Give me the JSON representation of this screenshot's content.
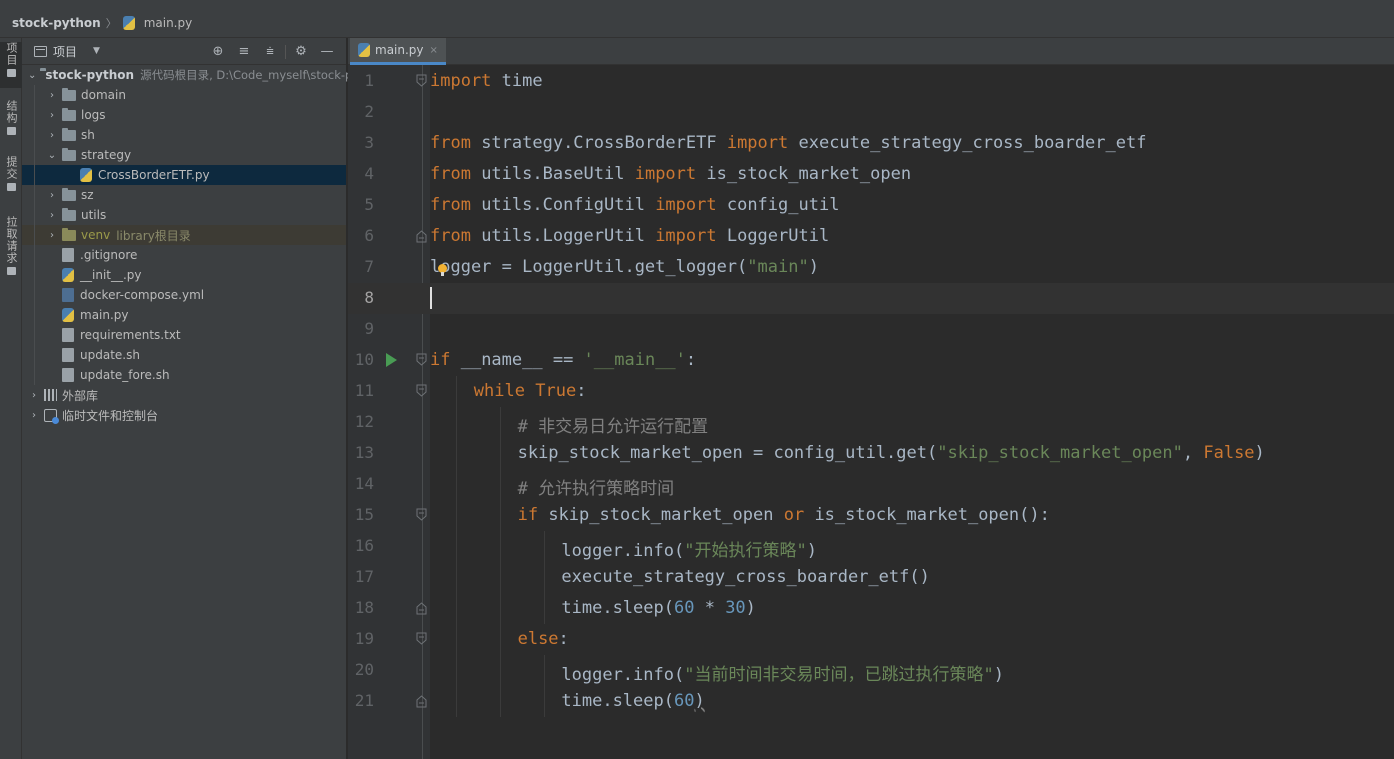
{
  "breadcrumb": {
    "project": "stock-python",
    "file": "main.py"
  },
  "left_strip": [
    {
      "label": "项目",
      "icon": "folder-icon"
    },
    {
      "label": "结构",
      "icon": "structure-icon"
    },
    {
      "label": "提交",
      "icon": "commit-icon"
    },
    {
      "label": "拉取请求",
      "icon": "pull-request-icon"
    }
  ],
  "project_panel": {
    "title": "项目",
    "root": {
      "name": "stock-python",
      "hint": "源代码根目录, D:\\Code_myself\\stock-python"
    },
    "tree": [
      {
        "type": "folder",
        "name": "domain",
        "depth": 1,
        "expanded": false
      },
      {
        "type": "folder",
        "name": "logs",
        "depth": 1,
        "expanded": false
      },
      {
        "type": "folder",
        "name": "sh",
        "depth": 1,
        "expanded": false
      },
      {
        "type": "folder",
        "name": "strategy",
        "depth": 1,
        "expanded": true
      },
      {
        "type": "file",
        "kind": "py",
        "name": "CrossBorderETF.py",
        "depth": 2,
        "selected": true
      },
      {
        "type": "folder",
        "name": "sz",
        "depth": 1,
        "expanded": false
      },
      {
        "type": "folder",
        "name": "utils",
        "depth": 1,
        "expanded": false
      },
      {
        "type": "venv",
        "name": "venv",
        "hint": "library根目录",
        "depth": 1,
        "expanded": false
      },
      {
        "type": "file",
        "kind": "git",
        "name": ".gitignore",
        "depth": 1
      },
      {
        "type": "file",
        "kind": "py",
        "name": "__init__.py",
        "depth": 1
      },
      {
        "type": "file",
        "kind": "yml",
        "name": "docker-compose.yml",
        "depth": 1
      },
      {
        "type": "file",
        "kind": "py",
        "name": "main.py",
        "depth": 1
      },
      {
        "type": "file",
        "kind": "txt",
        "name": "requirements.txt",
        "depth": 1
      },
      {
        "type": "file",
        "kind": "sh",
        "name": "update.sh",
        "depth": 1
      },
      {
        "type": "file",
        "kind": "sh",
        "name": "update_fore.sh",
        "depth": 1
      }
    ],
    "bottom_items": [
      {
        "name": "外部库",
        "icon": "library-icon"
      },
      {
        "name": "临时文件和控制台",
        "icon": "scratches-icon"
      }
    ]
  },
  "editor": {
    "tab": {
      "label": "main.py",
      "close": "×"
    },
    "current_line": 8,
    "lines": [
      {
        "n": 1,
        "fold": "open",
        "indent": 0,
        "tokens": [
          {
            "t": "import",
            "c": "k"
          },
          {
            "t": " time",
            "c": "t"
          }
        ]
      },
      {
        "n": 2,
        "indent": 0,
        "tokens": []
      },
      {
        "n": 3,
        "indent": 0,
        "tokens": [
          {
            "t": "from",
            "c": "k"
          },
          {
            "t": " strategy.CrossBorderETF ",
            "c": "t"
          },
          {
            "t": "import",
            "c": "k"
          },
          {
            "t": " execute_strategy_cross_boarder_etf",
            "c": "t"
          }
        ]
      },
      {
        "n": 4,
        "indent": 0,
        "tokens": [
          {
            "t": "from",
            "c": "k"
          },
          {
            "t": " utils.BaseUtil ",
            "c": "t"
          },
          {
            "t": "import",
            "c": "k"
          },
          {
            "t": " is_stock_market_open",
            "c": "t"
          }
        ]
      },
      {
        "n": 5,
        "indent": 0,
        "tokens": [
          {
            "t": "from",
            "c": "k"
          },
          {
            "t": " utils.ConfigUtil ",
            "c": "t"
          },
          {
            "t": "import",
            "c": "k"
          },
          {
            "t": " config_util",
            "c": "t"
          }
        ]
      },
      {
        "n": 6,
        "fold": "close",
        "indent": 0,
        "tokens": [
          {
            "t": "from",
            "c": "k"
          },
          {
            "t": " utils.LoggerUtil ",
            "c": "t"
          },
          {
            "t": "import",
            "c": "k"
          },
          {
            "t": " LoggerUtil",
            "c": "t"
          }
        ]
      },
      {
        "n": 7,
        "indent": 0,
        "tokens": [
          {
            "t": "logger = LoggerUtil.get_logger(",
            "c": "t"
          },
          {
            "t": "\"main\"",
            "c": "s"
          },
          {
            "t": ")",
            "c": "t"
          }
        ]
      },
      {
        "n": 8,
        "indent": 0,
        "tokens": []
      },
      {
        "n": 9,
        "indent": 0,
        "tokens": []
      },
      {
        "n": 10,
        "run": true,
        "fold": "open",
        "indent": 0,
        "tokens": [
          {
            "t": "if",
            "c": "k"
          },
          {
            "t": " __name__ == ",
            "c": "t"
          },
          {
            "t": "'__main__'",
            "c": "s"
          },
          {
            "t": ":",
            "c": "t"
          }
        ]
      },
      {
        "n": 11,
        "fold": "open",
        "indent": 1,
        "tokens": [
          {
            "t": "while",
            "c": "k"
          },
          {
            "t": " ",
            "c": "t"
          },
          {
            "t": "True",
            "c": "k"
          },
          {
            "t": ":",
            "c": "t"
          }
        ]
      },
      {
        "n": 12,
        "indent": 2,
        "tokens": [
          {
            "t": "# 非交易日允许运行配置",
            "c": "c"
          }
        ]
      },
      {
        "n": 13,
        "indent": 2,
        "tokens": [
          {
            "t": "skip_stock_market_open = config_util.get(",
            "c": "t"
          },
          {
            "t": "\"skip_stock_market_open\"",
            "c": "s"
          },
          {
            "t": ", ",
            "c": "t"
          },
          {
            "t": "False",
            "c": "k"
          },
          {
            "t": ")",
            "c": "t"
          }
        ]
      },
      {
        "n": 14,
        "indent": 2,
        "tokens": [
          {
            "t": "# 允许执行策略时间",
            "c": "c"
          }
        ]
      },
      {
        "n": 15,
        "fold": "open",
        "indent": 2,
        "tokens": [
          {
            "t": "if",
            "c": "k"
          },
          {
            "t": " skip_stock_market_open ",
            "c": "t"
          },
          {
            "t": "or",
            "c": "k"
          },
          {
            "t": " is_stock_market_open():",
            "c": "t"
          }
        ]
      },
      {
        "n": 16,
        "indent": 3,
        "tokens": [
          {
            "t": "logger.info(",
            "c": "t"
          },
          {
            "t": "\"开始执行策略\"",
            "c": "s"
          },
          {
            "t": ")",
            "c": "t"
          }
        ]
      },
      {
        "n": 17,
        "indent": 3,
        "tokens": [
          {
            "t": "execute_strategy_cross_boarder_etf()",
            "c": "t"
          }
        ]
      },
      {
        "n": 18,
        "fold": "close",
        "indent": 3,
        "tokens": [
          {
            "t": "time.sleep(",
            "c": "t"
          },
          {
            "t": "60",
            "c": "n"
          },
          {
            "t": " * ",
            "c": "t"
          },
          {
            "t": "30",
            "c": "n"
          },
          {
            "t": ")",
            "c": "t"
          }
        ]
      },
      {
        "n": 19,
        "fold": "open",
        "indent": 2,
        "tokens": [
          {
            "t": "else",
            "c": "k"
          },
          {
            "t": ":",
            "c": "t"
          }
        ]
      },
      {
        "n": 20,
        "indent": 3,
        "tokens": [
          {
            "t": "logger.info(",
            "c": "t"
          },
          {
            "t": "\"当前时间非交易时间，已跳过执行策略\"",
            "c": "s"
          },
          {
            "t": ")",
            "c": "t"
          }
        ]
      },
      {
        "n": 21,
        "fold": "close",
        "indent": 3,
        "tokens": [
          {
            "t": "time.sleep(",
            "c": "t"
          },
          {
            "t": "60",
            "c": "n"
          },
          {
            "t": ")",
            "c": "w"
          }
        ]
      }
    ]
  },
  "colors": {
    "keyword": "#cc7832",
    "string": "#6a8759",
    "number": "#6897bb",
    "comment": "#808080",
    "text": "#a9b7c6",
    "selection": "#0d293e",
    "tab_underline": "#4a88c7",
    "run": "#499c54"
  }
}
